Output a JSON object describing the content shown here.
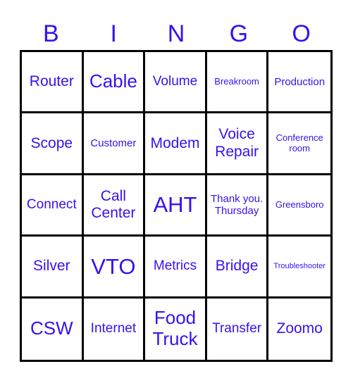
{
  "colors": {
    "accent": "#3a0ff0",
    "grid_line": "#000000",
    "background": "#ffffff"
  },
  "header": [
    "B",
    "I",
    "N",
    "G",
    "O"
  ],
  "cells": [
    [
      "Router",
      "Cable",
      "Volume",
      "Breakroom",
      "Production"
    ],
    [
      "Scope",
      "Customer",
      "Modem",
      "Voice Repair",
      "Conference room"
    ],
    [
      "Connect",
      "Call Center",
      "AHT",
      "Thank you. Thursday",
      "Greensboro"
    ],
    [
      "Silver",
      "VTO",
      "Metrics",
      "Bridge",
      "Troubleshooter"
    ],
    [
      "CSW",
      "Internet",
      "Food Truck",
      "Transfer",
      "Zoomo"
    ]
  ]
}
